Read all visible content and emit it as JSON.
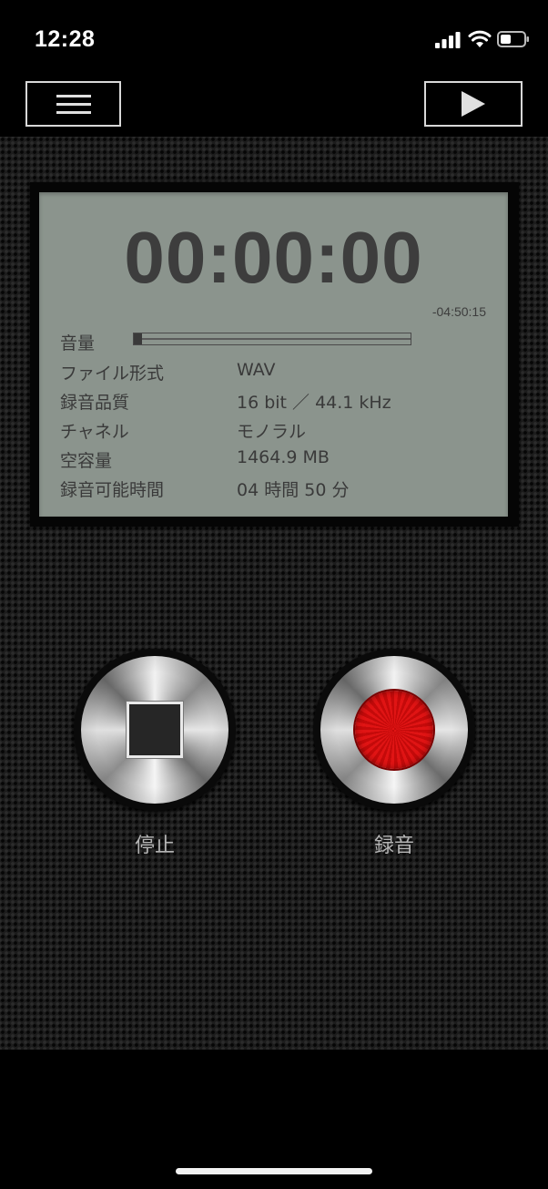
{
  "status_bar": {
    "time": "12:28"
  },
  "toolbar": {
    "menu_icon": "hamburger-menu-icon",
    "play_icon": "play-icon"
  },
  "display": {
    "elapsed": "00:00:00",
    "remaining": "-04:50:15",
    "level_label": "音量",
    "level_fraction": 0.03,
    "rows": [
      {
        "label": "ファイル形式",
        "value": "WAV"
      },
      {
        "label": "録音品質",
        "value": "16 bit ／ 44.1 kHz"
      },
      {
        "label": "チャネル",
        "value": "モノラル"
      },
      {
        "label": "空容量",
        "value": "1464.9 MB"
      },
      {
        "label": "録音可能時間",
        "value": "04 時間 50 分"
      }
    ]
  },
  "controls": {
    "stop_label": "停止",
    "record_label": "録音"
  },
  "colors": {
    "lcd_background": "#8b948d",
    "lcd_text": "#3d3d3d",
    "record_red": "#e01414"
  }
}
